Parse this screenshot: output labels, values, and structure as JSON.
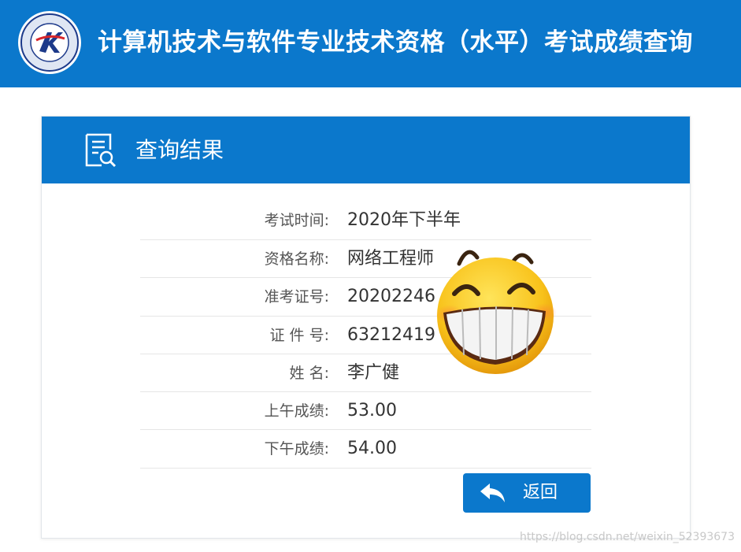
{
  "header": {
    "logo_icon": "ruankao-seal-logo",
    "title": "计算机技术与软件专业技术资格（水平）考试成绩查询"
  },
  "result_panel": {
    "title": "查询结果",
    "title_icon": "document-search-icon",
    "fields": [
      {
        "label": "考试时间:",
        "value": "2020年下半年"
      },
      {
        "label": "资格名称:",
        "value": "网络工程师"
      },
      {
        "label": "准考证号:",
        "value": "20202246"
      },
      {
        "label": "证 件 号:",
        "value": "63212419"
      },
      {
        "label": "姓 名:",
        "value": "李广健"
      },
      {
        "label": "上午成绩:",
        "value": "53.00"
      },
      {
        "label": "下午成绩:",
        "value": "54.00"
      }
    ],
    "back_button": {
      "label": "返回",
      "icon": "reply-arrow-icon"
    }
  },
  "overlay": {
    "icon": "grinning-face-emoji"
  },
  "watermark": "https://blog.csdn.net/weixin_52393673",
  "colors": {
    "primary": "#0b78cc",
    "background": "#ffffff"
  }
}
